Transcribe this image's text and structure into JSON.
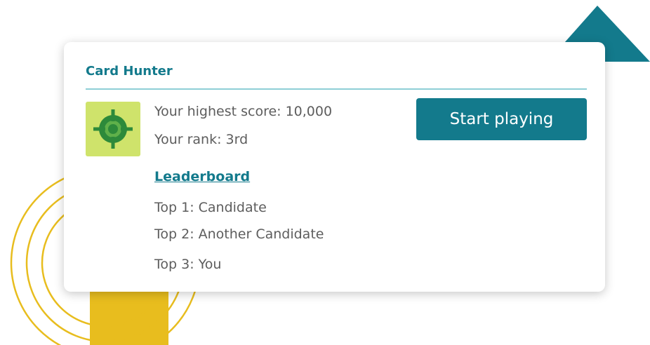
{
  "card": {
    "title": "Card Hunter",
    "icon": "crosshair-target-icon",
    "highest_score": "Your highest score: 10,000",
    "rank": "Your rank: 3rd",
    "start_label": "Start playing",
    "leaderboard_label": "Leaderboard",
    "leaderboard": [
      "Top 1: Candidate",
      "Top 2: Another Candidate",
      "Top 3: You"
    ]
  },
  "colors": {
    "accent": "#137a8c",
    "divider": "#8ecfd6",
    "icon_background": "#cfe36b",
    "icon_green": "#2d8a3a",
    "decor_yellow": "#e8bd1e",
    "decor_teal": "#137a8c",
    "text": "#5d5d5d"
  }
}
